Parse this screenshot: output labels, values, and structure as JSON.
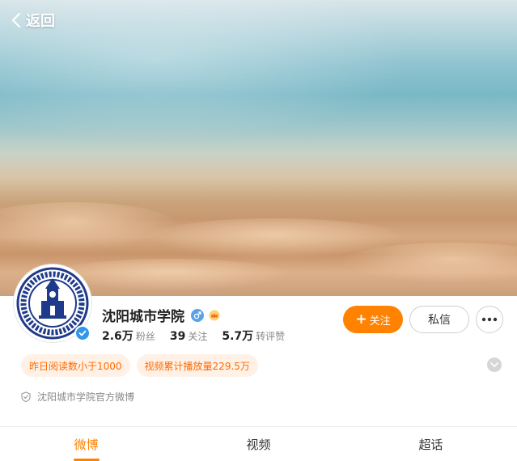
{
  "header": {
    "back_label": "返回"
  },
  "profile": {
    "name": "沈阳城市学院",
    "stats": [
      {
        "value": "2.6万",
        "label": "粉丝"
      },
      {
        "value": "39",
        "label": "关注"
      },
      {
        "value": "5.7万",
        "label": "转评赞"
      }
    ],
    "follow_label": "关注",
    "message_label": "私信",
    "tags": [
      "昨日阅读数小于1000",
      "视频累计播放量229.5万"
    ],
    "verified_desc": "沈阳城市学院官方微博"
  },
  "tabs": [
    {
      "label": "微博",
      "active": true
    },
    {
      "label": "视频",
      "active": false
    },
    {
      "label": "超话",
      "active": false
    }
  ],
  "colors": {
    "accent": "#ff8200",
    "verified": "#2f97ea",
    "tag_text": "#ff6a00"
  }
}
